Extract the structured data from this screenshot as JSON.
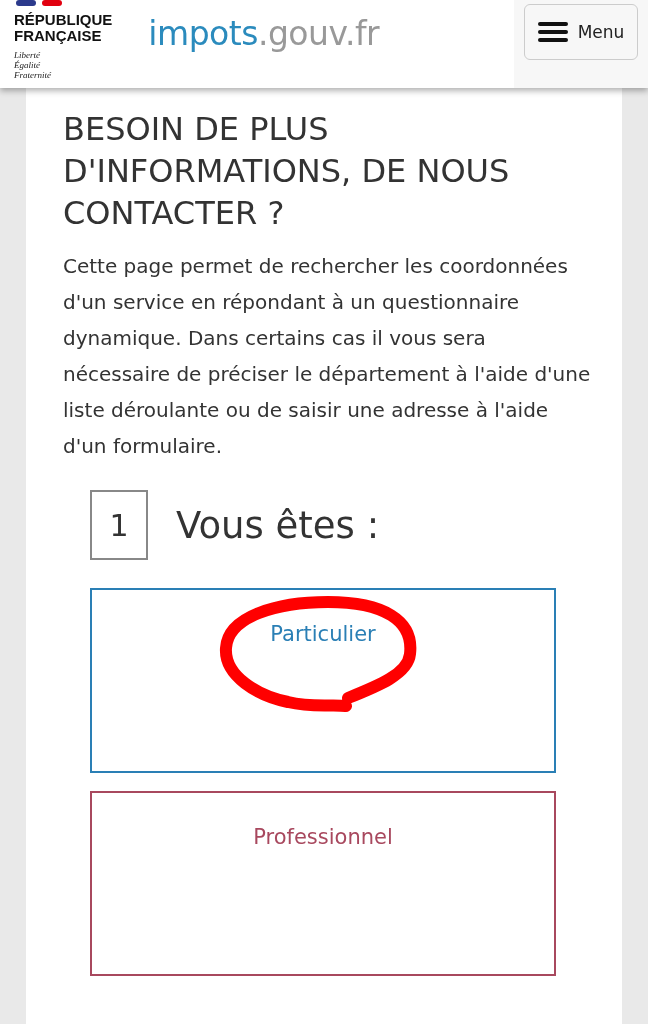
{
  "header": {
    "republic": [
      "RÉPUBLIQUE",
      "FRANÇAISE"
    ],
    "motto": [
      "Liberté",
      "Égalité",
      "Fraternité"
    ],
    "logo": {
      "primary": "impots",
      "secondary": ".gouv.fr"
    },
    "menu_button": "Menu"
  },
  "title": "BESOIN DE PLUS D'INFORMATIONS, DE NOUS CONTACTER ?",
  "intro": "Cette page permet de rechercher les coordonnées d'un service en répondant à un questionnaire dynamique. Dans certains cas il vous sera nécessaire de préciser le département à l'aide d'une liste déroulante ou de saisir une adresse à l'aide d'un formulaire.",
  "step": {
    "number": "1",
    "label": "Vous êtes :"
  },
  "options": [
    {
      "label": "Particulier",
      "color": "#2a7fb5",
      "circled": true
    },
    {
      "label": "Professionnel",
      "color": "#a8485e",
      "circled": false
    }
  ]
}
